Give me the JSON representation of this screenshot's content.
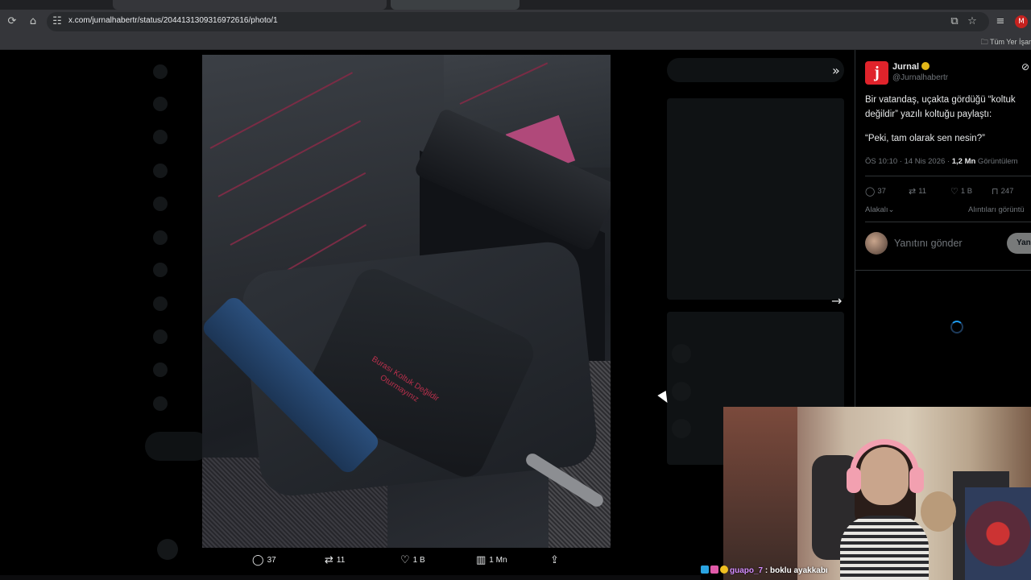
{
  "browser": {
    "url": "x.com/jurnalhabertr/status/2044131309316972616/photo/1",
    "bookmarks_label": "Tüm Yer İşar",
    "profile_initial": "M"
  },
  "photo": {
    "seat_text_line1": "Burası Koltuk Değildir",
    "seat_text_line2": "Oturmayınız",
    "actions": {
      "replies": "37",
      "reposts": "11",
      "likes": "1 B",
      "views": "1 Mn"
    }
  },
  "tweet": {
    "author_name": "Jurnal",
    "author_handle": "@Jurnalhabertr",
    "avatar_letter": "j",
    "text_line1": "Bir vatandaş, uçakta gördüğü “koltuk",
    "text_line2": "değildir” yazılı koltuğu paylaştı:",
    "quote": "“Peki, tam olarak sen nesin?”",
    "time": "ÖS 10:10 · 14 Nis 2026 · ",
    "views_count": "1,2 Mn",
    "views_label": " Görüntülem",
    "replies": "37",
    "reposts": "11",
    "likes": "1 B",
    "bookmarks": "247",
    "relevant_link": "Alakalı",
    "quotes_link": "Alıntıları görüntü",
    "reply_placeholder": "Yanıtını gönder",
    "reply_button": "Yanıtla"
  },
  "chat": {
    "username": "guapo_7",
    "message": " : boklu ayakkabı"
  },
  "colors": {
    "accent": "#1d9bf0",
    "brand_red": "#e0232b",
    "verified_gold": "#e2b719"
  }
}
